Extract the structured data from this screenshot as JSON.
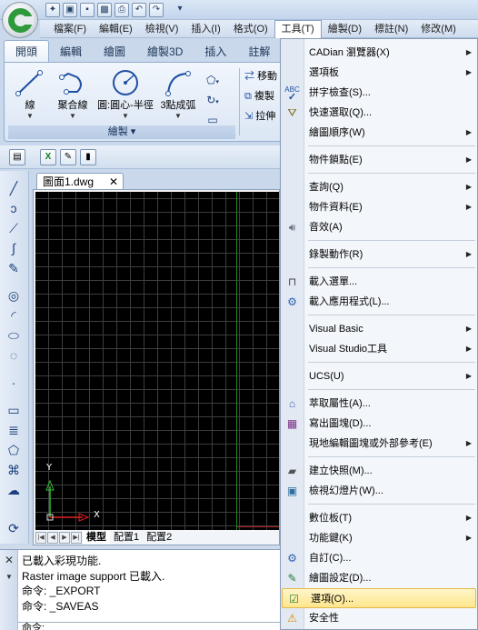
{
  "app": {
    "title_icons": [
      "new-icon",
      "open-icon",
      "save-icon",
      "saveas-icon",
      "print-icon",
      "undo-icon",
      "redo-icon"
    ]
  },
  "menubar": {
    "items": [
      {
        "label": "檔案(F)"
      },
      {
        "label": "編輯(E)"
      },
      {
        "label": "檢視(V)"
      },
      {
        "label": "插入(I)"
      },
      {
        "label": "格式(O)"
      },
      {
        "label": "工具(T)"
      },
      {
        "label": "繪製(D)"
      },
      {
        "label": "標註(N)"
      },
      {
        "label": "修改(M)"
      }
    ]
  },
  "ribbon": {
    "tabs": [
      {
        "label": "開頭"
      },
      {
        "label": "編輯"
      },
      {
        "label": "繪圖"
      },
      {
        "label": "繪製3D"
      },
      {
        "label": "插入"
      },
      {
        "label": "註解"
      }
    ],
    "draw_tools": [
      {
        "label": "線"
      },
      {
        "label": "聚合線"
      },
      {
        "label": "圓:圓心-半徑"
      },
      {
        "label": "3點成弧"
      }
    ],
    "group_label": "繪製",
    "right_labels": [
      "移動",
      "複製",
      "拉伸"
    ]
  },
  "document": {
    "tab_title": "圖面1.dwg",
    "axis_x": "X",
    "axis_y": "Y",
    "sheets": [
      {
        "label": "模型"
      },
      {
        "label": "配置1"
      },
      {
        "label": "配置2"
      }
    ]
  },
  "command": {
    "lines": [
      "已載入彩現功能.",
      "Raster image support 已載入.",
      "命令: _EXPORT",
      "命令: _SAVEAS"
    ],
    "prompt": "命令:"
  },
  "tools_menu": {
    "items": [
      {
        "label": "CADian 瀏覽器(X)",
        "submenu": true,
        "icon": ""
      },
      {
        "label": "選項板",
        "submenu": true,
        "icon": ""
      },
      {
        "label": "拼字檢查(S)...",
        "submenu": false,
        "icon": "spellcheck-icon"
      },
      {
        "label": "快速選取(Q)...",
        "submenu": false,
        "icon": "quick-select-icon"
      },
      {
        "label": "繪圖順序(W)",
        "submenu": true,
        "icon": ""
      },
      {
        "label": "物件鎖點(E)",
        "submenu": true,
        "icon": ""
      },
      {
        "label": "查詢(Q)",
        "submenu": true,
        "icon": ""
      },
      {
        "label": "物件資料(E)",
        "submenu": true,
        "icon": ""
      },
      {
        "label": "音效(A)",
        "submenu": false,
        "icon": "sound-icon"
      },
      {
        "label": "錄製動作(R)",
        "submenu": true,
        "icon": ""
      },
      {
        "label": "載入選單...",
        "submenu": false,
        "icon": "load-menu-icon"
      },
      {
        "label": "載入應用程式(L)...",
        "submenu": false,
        "icon": "load-app-icon"
      },
      {
        "label": "Visual Basic",
        "submenu": true,
        "icon": ""
      },
      {
        "label": "Visual Studio工具",
        "submenu": true,
        "icon": ""
      },
      {
        "label": "UCS(U)",
        "submenu": true,
        "icon": ""
      },
      {
        "label": "萃取屬性(A)...",
        "submenu": false,
        "icon": "extract-attr-icon"
      },
      {
        "label": "寫出圖塊(D)...",
        "submenu": false,
        "icon": "write-block-icon"
      },
      {
        "label": "現地編輯圖塊或外部參考(E)",
        "submenu": true,
        "icon": ""
      },
      {
        "label": "建立快照(M)...",
        "submenu": false,
        "icon": "camera-icon"
      },
      {
        "label": "檢視幻燈片(W)...",
        "submenu": false,
        "icon": "slide-icon"
      },
      {
        "label": "數位板(T)",
        "submenu": true,
        "icon": ""
      },
      {
        "label": "功能鍵(K)",
        "submenu": true,
        "icon": ""
      },
      {
        "label": "自訂(C)...",
        "submenu": false,
        "icon": "customize-icon"
      },
      {
        "label": "繪圖設定(D)...",
        "submenu": false,
        "icon": "draw-settings-icon"
      },
      {
        "label": "選項(O)...",
        "submenu": false,
        "icon": "options-icon"
      },
      {
        "label": "安全性",
        "submenu": false,
        "icon": "warning-icon"
      }
    ]
  }
}
